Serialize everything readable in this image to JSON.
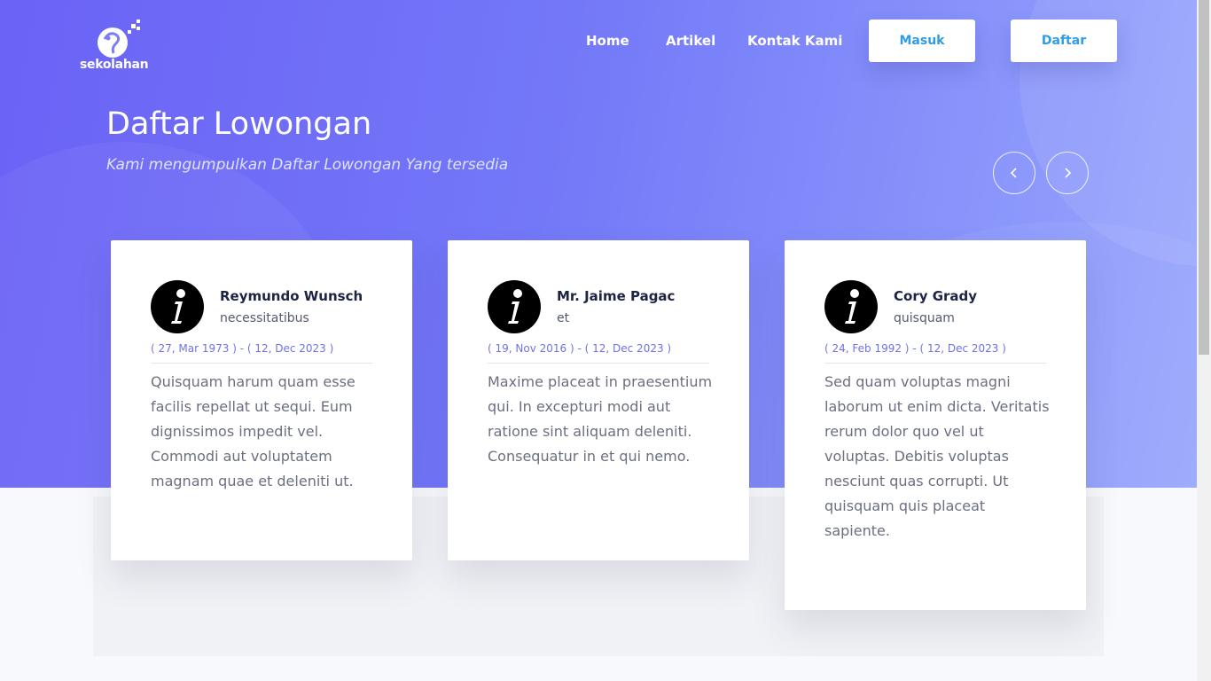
{
  "brand": {
    "logo_text": "sekolahan"
  },
  "nav": {
    "home": "Home",
    "artikel": "Artikel",
    "kontak": "Kontak Kami",
    "masuk": "Masuk",
    "daftar": "Daftar"
  },
  "hero": {
    "title": "Daftar Lowongan",
    "subtitle": "Kami mengumpulkan Daftar Lowongan Yang tersedia"
  },
  "carousel": {
    "prev_icon": "chevron-left-icon",
    "next_icon": "chevron-right-icon"
  },
  "cards": [
    {
      "name": "Reymundo Wunsch",
      "company": "necessitatibus",
      "dates": "( 27, Mar 1973 ) - ( 12, Dec 2023 )",
      "description": "Quisquam harum quam esse facilis repellat ut sequi. Eum dignissimos impedit vel. Commodi aut voluptatem magnam quae et deleniti ut."
    },
    {
      "name": "Mr. Jaime Pagac",
      "company": "et",
      "dates": "( 19, Nov 2016 ) - ( 12, Dec 2023 )",
      "description": "Maxime placeat in praesentium qui. In excepturi modi aut ratione sint aliquam deleniti. Consequatur in et qui nemo."
    },
    {
      "name": "Cory Grady",
      "company": "quisquam",
      "dates": "( 24, Feb 1992 ) - ( 12, Dec 2023 )",
      "description": "Sed quam voluptas magni laborum ut enim dicta. Veritatis rerum dolor quo vel ut voluptas. Debitis voluptas nesciunt quas corrupti. Ut quisquam quis placeat sapiente."
    }
  ],
  "colors": {
    "hero_start": "#6b62f6",
    "hero_end": "#99a8fc",
    "button_text": "#2e9ce6",
    "date_text": "#6f72e6"
  }
}
